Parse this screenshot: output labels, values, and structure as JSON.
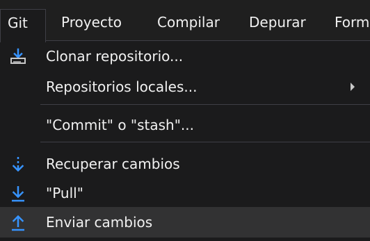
{
  "menubar": {
    "items": [
      {
        "label": "Git"
      },
      {
        "label": "Proyecto"
      },
      {
        "label": "Compilar"
      },
      {
        "label": "Depurar"
      },
      {
        "label": "Form"
      }
    ]
  },
  "git_menu": {
    "items": [
      {
        "label": "Clonar repositorio...",
        "icon": "clone-download-icon"
      },
      {
        "label": "Repositorios locales...",
        "has_submenu": true
      },
      {
        "label": "\"Commit\" o \"stash\"..."
      },
      {
        "label": "Recuperar cambios",
        "icon": "fetch-arrow-icon"
      },
      {
        "label": "\"Pull\"",
        "icon": "pull-arrow-icon"
      },
      {
        "label": "Enviar cambios",
        "icon": "push-arrow-icon",
        "highlighted": true
      }
    ]
  },
  "colors": {
    "background": "#1b1b1c",
    "menubar": "#1f1f1f",
    "text": "#f1f1f1",
    "highlight": "#323233",
    "separator": "#3f3f46",
    "icon_blue": "#3794ff",
    "icon_gray": "#c8c8c8"
  }
}
